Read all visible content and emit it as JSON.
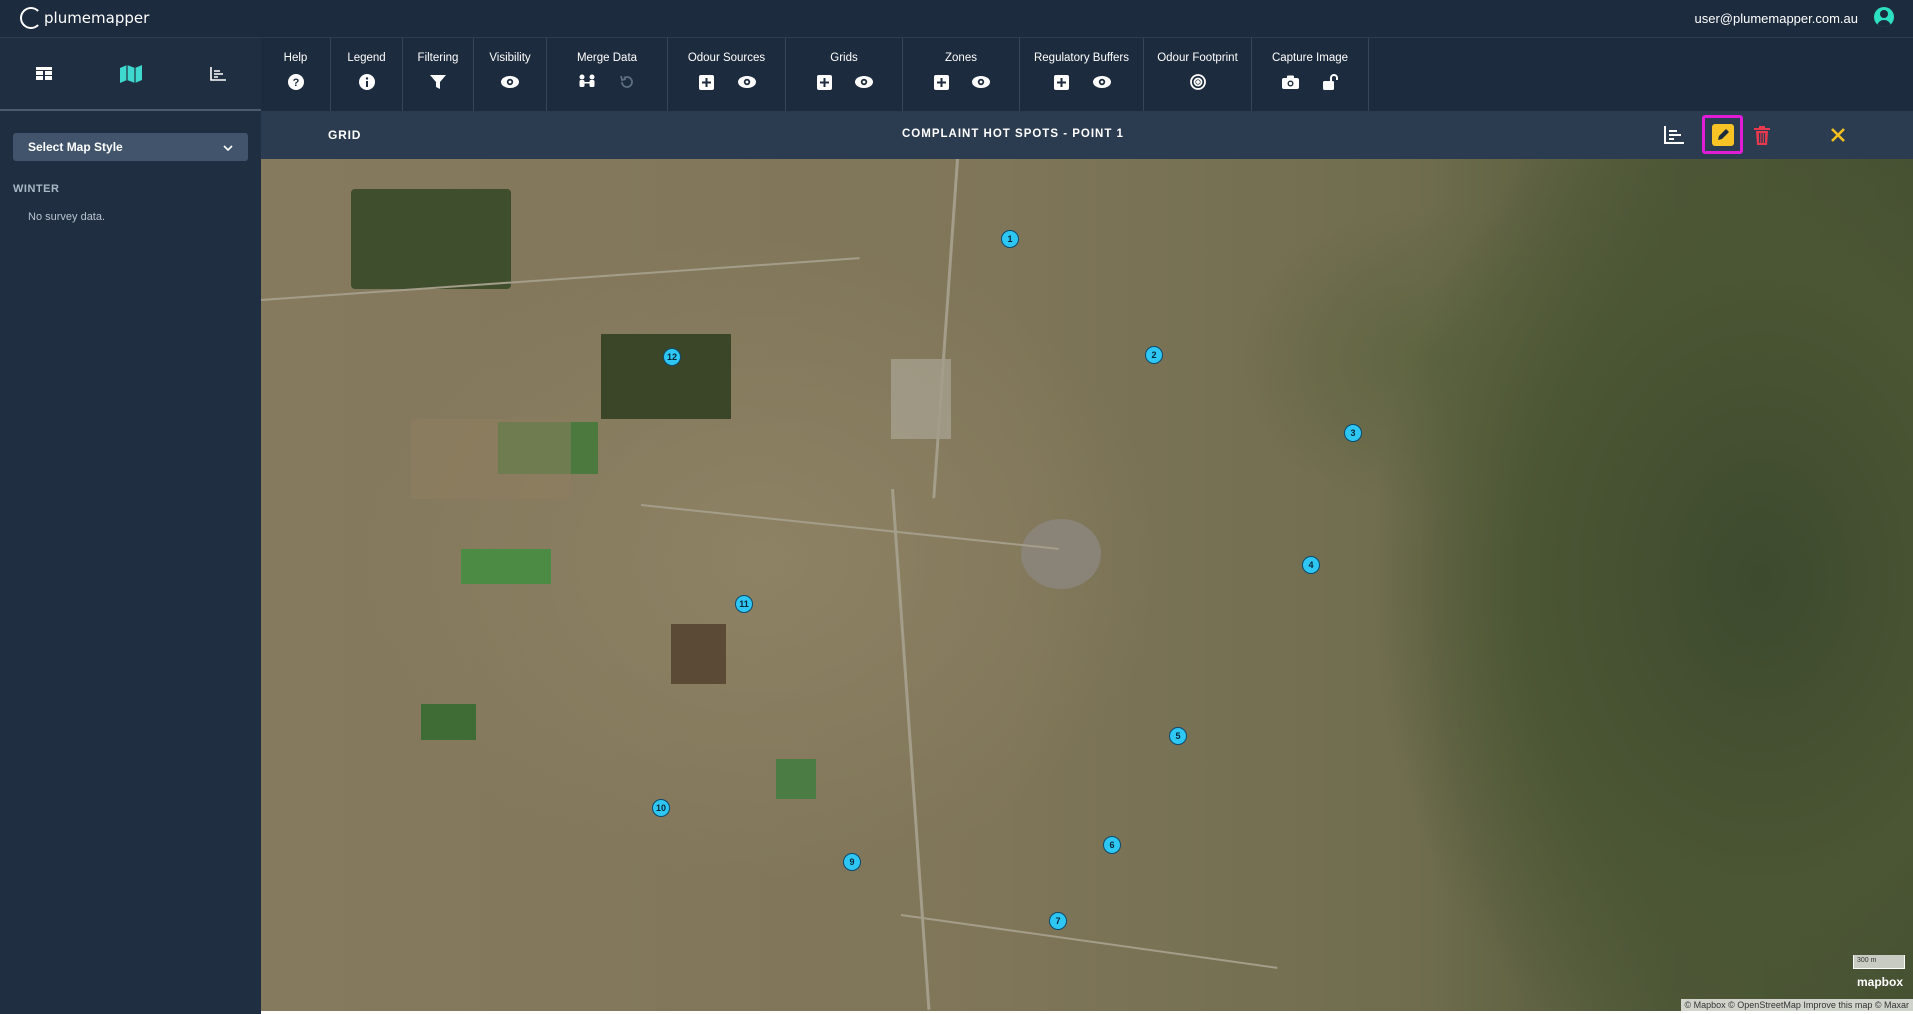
{
  "app": {
    "logo_text": "plumemapper",
    "user_email": "user@plumemapper.com.au"
  },
  "sidebar": {
    "tabs": [
      {
        "icon": "table-icon"
      },
      {
        "icon": "map-icon",
        "active": true
      },
      {
        "icon": "chart-icon"
      }
    ],
    "map_style_label": "Select Map Style",
    "season": "WINTER",
    "survey_text": "No survey data."
  },
  "toolbar": {
    "help": "Help",
    "legend": "Legend",
    "filtering": "Filtering",
    "visibility": "Visibility",
    "merge_data": "Merge Data",
    "odour_sources": "Odour Sources",
    "grids": "Grids",
    "zones": "Zones",
    "regulatory_buffers": "Regulatory Buffers",
    "odour_footprint": "Odour Footprint",
    "capture_image": "Capture Image"
  },
  "subbar": {
    "grid_label": "GRID",
    "title": "COMPLAINT HOT SPOTS - POINT 1"
  },
  "map": {
    "markers": [
      "1",
      "2",
      "3",
      "4",
      "5",
      "6",
      "7",
      "9",
      "10",
      "11",
      "12"
    ],
    "scale_label": "300 m",
    "mapbox_label": "mapbox",
    "attribution": "© Mapbox © OpenStreetMap Improve this map © Maxar"
  },
  "colors": {
    "accent": "#3ed8cf",
    "marker": "#2ec6f2",
    "edit": "#f7c325",
    "delete": "#e8394f",
    "close": "#f2c01e",
    "highlight": "#e11cd6"
  }
}
